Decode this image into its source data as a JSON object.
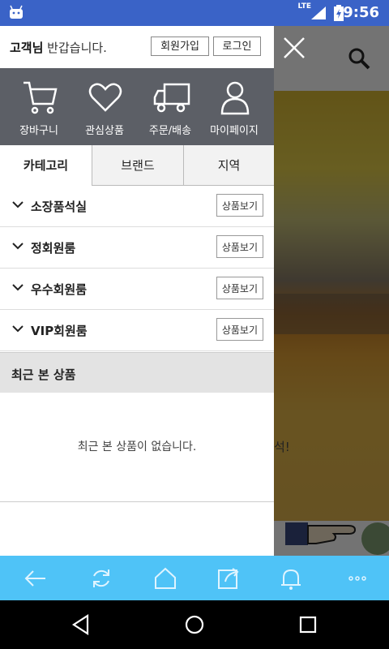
{
  "status": {
    "time": "9:56",
    "network": "LTE"
  },
  "drawer": {
    "greeting_name": "고객님",
    "greeting_rest": " 반갑습니다.",
    "join_label": "회원가입",
    "login_label": "로그인",
    "quick_menu": [
      {
        "label": "장바구니",
        "icon": "cart-icon"
      },
      {
        "label": "관심상품",
        "icon": "heart-icon"
      },
      {
        "label": "주문/배송",
        "icon": "truck-icon"
      },
      {
        "label": "마이페이지",
        "icon": "person-icon"
      }
    ],
    "tabs": [
      "카테고리",
      "브랜드",
      "지역"
    ],
    "active_tab": "카테고리",
    "categories": [
      {
        "name": "소장품석실",
        "action": "상품보기"
      },
      {
        "name": "정회원룸",
        "action": "상품보기"
      },
      {
        "name": "우수회원룸",
        "action": "상품보기"
      },
      {
        "name": "VIP회원룸",
        "action": "상품보기"
      }
    ],
    "recent_title": "최근 본 상품",
    "recent_empty": "최근 본 상품이 없습니다."
  },
  "background": {
    "caption_fragment": "석!"
  },
  "toolbar": {
    "icons": [
      "back-arrow-icon",
      "refresh-icon",
      "home-icon",
      "share-icon",
      "bell-icon",
      "more-icon"
    ]
  },
  "colors": {
    "status_bar": "#3a63c7",
    "quick_menu_bg": "#5c5f66",
    "toolbar_bg": "#4fc3f7"
  }
}
